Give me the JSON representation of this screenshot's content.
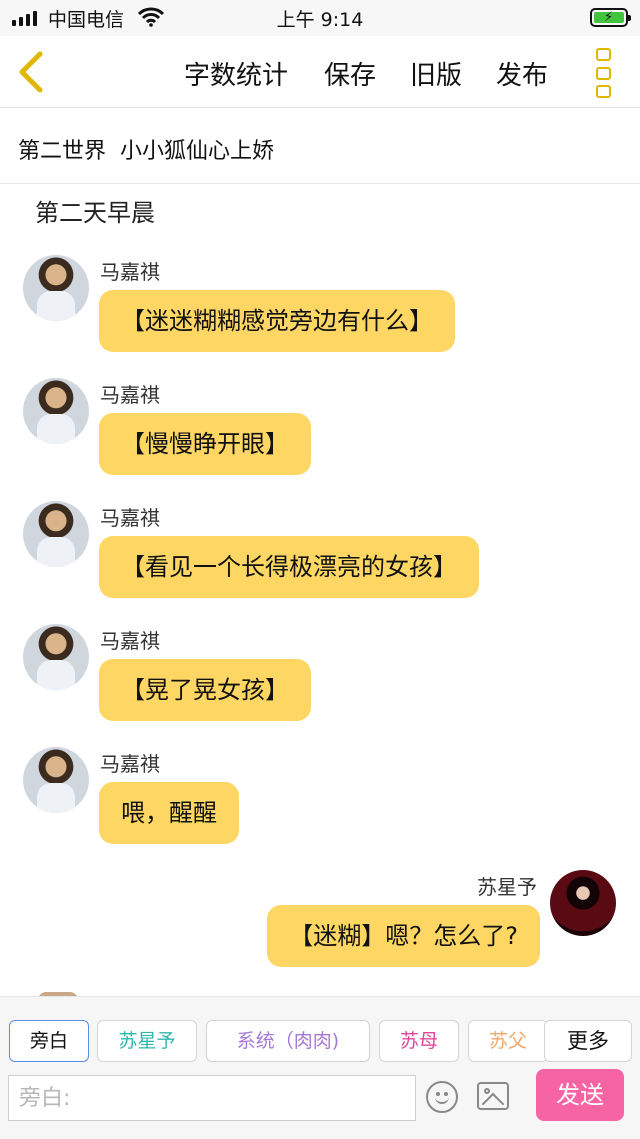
{
  "status_bar": {
    "carrier": "中国电信",
    "time": "上午 9:14",
    "signal_icon": "signal-bars-icon",
    "wifi_icon": "wifi-icon",
    "battery_icon": "battery-charging-icon"
  },
  "nav": {
    "back_icon": "chevron-left-icon",
    "word_count": "字数统计",
    "save": "保存",
    "old_version": "旧版",
    "publish": "发布",
    "more_icon": "vertical-dots-icon",
    "accent_color": "#e0b800"
  },
  "story": {
    "title": "第二世界  小小狐仙心上娇",
    "scene": "第二天早晨"
  },
  "messages": [
    {
      "sender": "马嘉祺",
      "text": "【迷迷糊糊感觉旁边有什么】",
      "side": "left"
    },
    {
      "sender": "马嘉祺",
      "text": "【慢慢睁开眼】",
      "side": "left"
    },
    {
      "sender": "马嘉祺",
      "text": "【看见一个长得极漂亮的女孩】",
      "side": "left"
    },
    {
      "sender": "马嘉祺",
      "text": "【晃了晃女孩】",
      "side": "left"
    },
    {
      "sender": "马嘉祺",
      "text": "喂，醒醒",
      "side": "left"
    },
    {
      "sender": "苏星予",
      "text": "【迷糊】嗯？怎么了?",
      "side": "right"
    }
  ],
  "bubble_color": "#fdd663",
  "role_chips": [
    {
      "label": "旁白",
      "color": "#111111"
    },
    {
      "label": "苏星予",
      "color": "#2fb7ae"
    },
    {
      "label": "系统（肉肉)",
      "color": "#a678d8"
    },
    {
      "label": "苏母",
      "color": "#e0479a"
    },
    {
      "label": "苏父",
      "color": "#f2a86a"
    },
    {
      "label": "更多",
      "color": "#111111"
    }
  ],
  "composer": {
    "placeholder": "旁白:",
    "emoji_icon": "smiley-icon",
    "image_icon": "image-icon",
    "send": "发送",
    "send_color": "#f764a3"
  }
}
